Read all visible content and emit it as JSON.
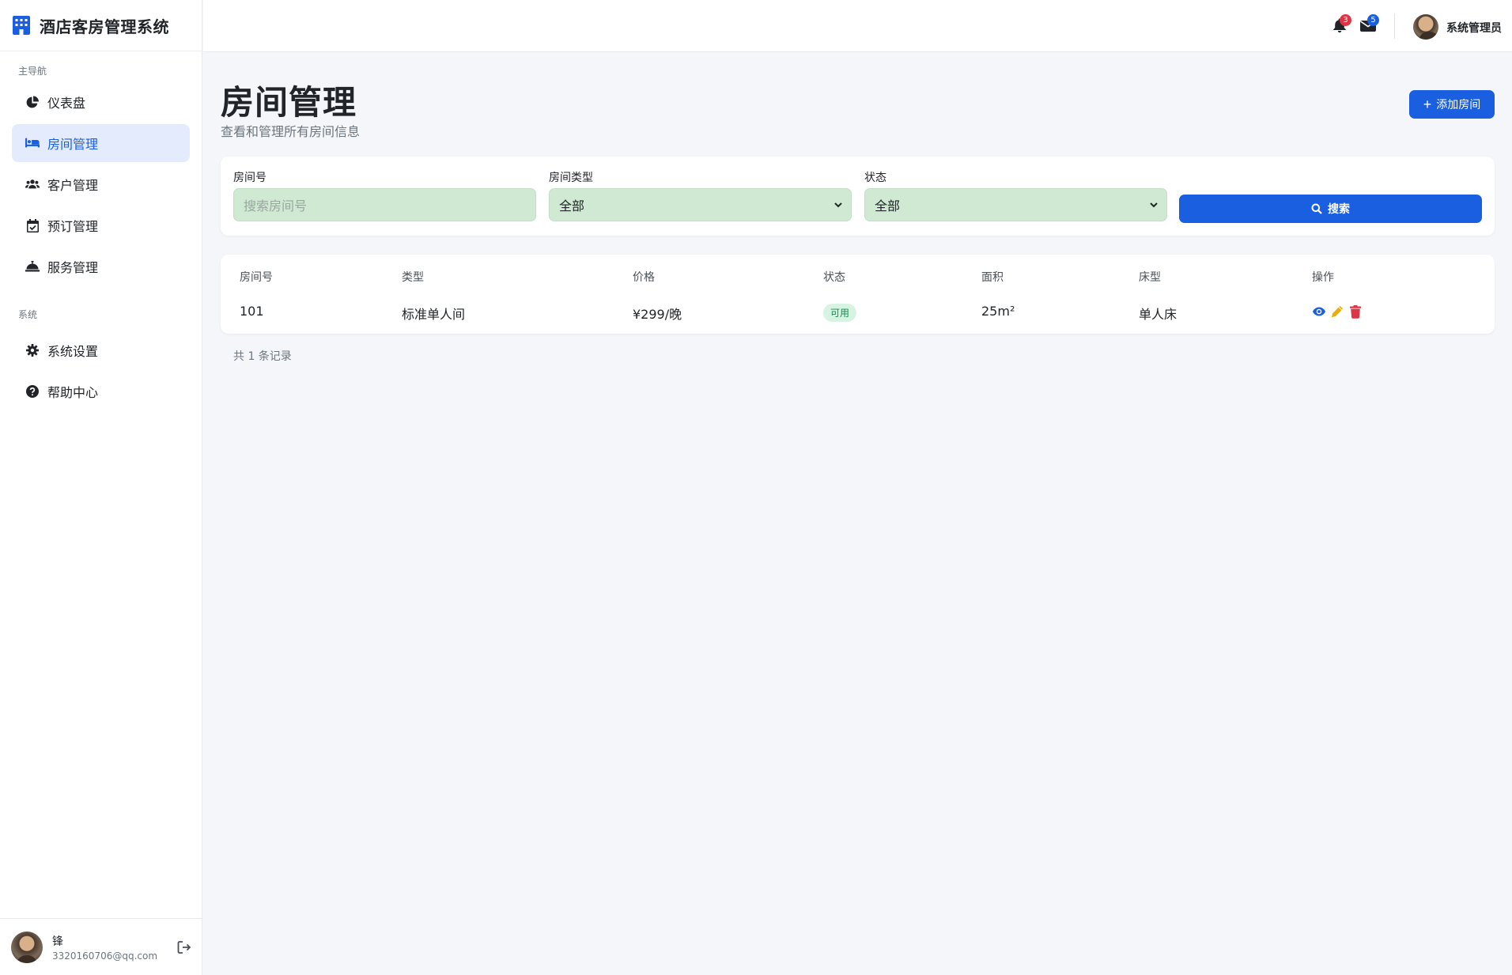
{
  "app": {
    "title": "酒店客房管理系统"
  },
  "sidebar": {
    "section_main": "主导航",
    "section_system": "系统",
    "items": [
      {
        "label": "仪表盘",
        "icon": "pie-chart-icon"
      },
      {
        "label": "房间管理",
        "icon": "bed-icon",
        "active": true
      },
      {
        "label": "客户管理",
        "icon": "users-icon"
      },
      {
        "label": "预订管理",
        "icon": "calendar-check-icon"
      },
      {
        "label": "服务管理",
        "icon": "concierge-bell-icon"
      }
    ],
    "system_items": [
      {
        "label": "系统设置",
        "icon": "gear-icon"
      },
      {
        "label": "帮助中心",
        "icon": "question-circle-icon"
      }
    ],
    "user": {
      "name": "锋",
      "email": "3320160706@qq.com"
    }
  },
  "topbar": {
    "notifications_count": "3",
    "messages_count": "5",
    "user_name": "系统管理员"
  },
  "page": {
    "title": "房间管理",
    "subtitle": "查看和管理所有房间信息",
    "add_button": "添加房间"
  },
  "filters": {
    "room_no_label": "房间号",
    "room_no_placeholder": "搜索房间号",
    "room_type_label": "房间类型",
    "room_type_value": "全部",
    "status_label": "状态",
    "status_value": "全部",
    "search_button": "搜索"
  },
  "table": {
    "headers": [
      "房间号",
      "类型",
      "价格",
      "状态",
      "面积",
      "床型",
      "操作"
    ],
    "rows": [
      {
        "room_no": "101",
        "type": "标准单人间",
        "price": "¥299/晚",
        "status": "可用",
        "area": "25m²",
        "bed": "单人床"
      }
    ]
  },
  "footer": {
    "record_count": "共 1 条记录"
  },
  "colors": {
    "primary": "#1a5fe0",
    "success": "#198754",
    "danger": "#dc3545",
    "warning": "#f0ad00",
    "input_bg": "#cfe9d2"
  }
}
